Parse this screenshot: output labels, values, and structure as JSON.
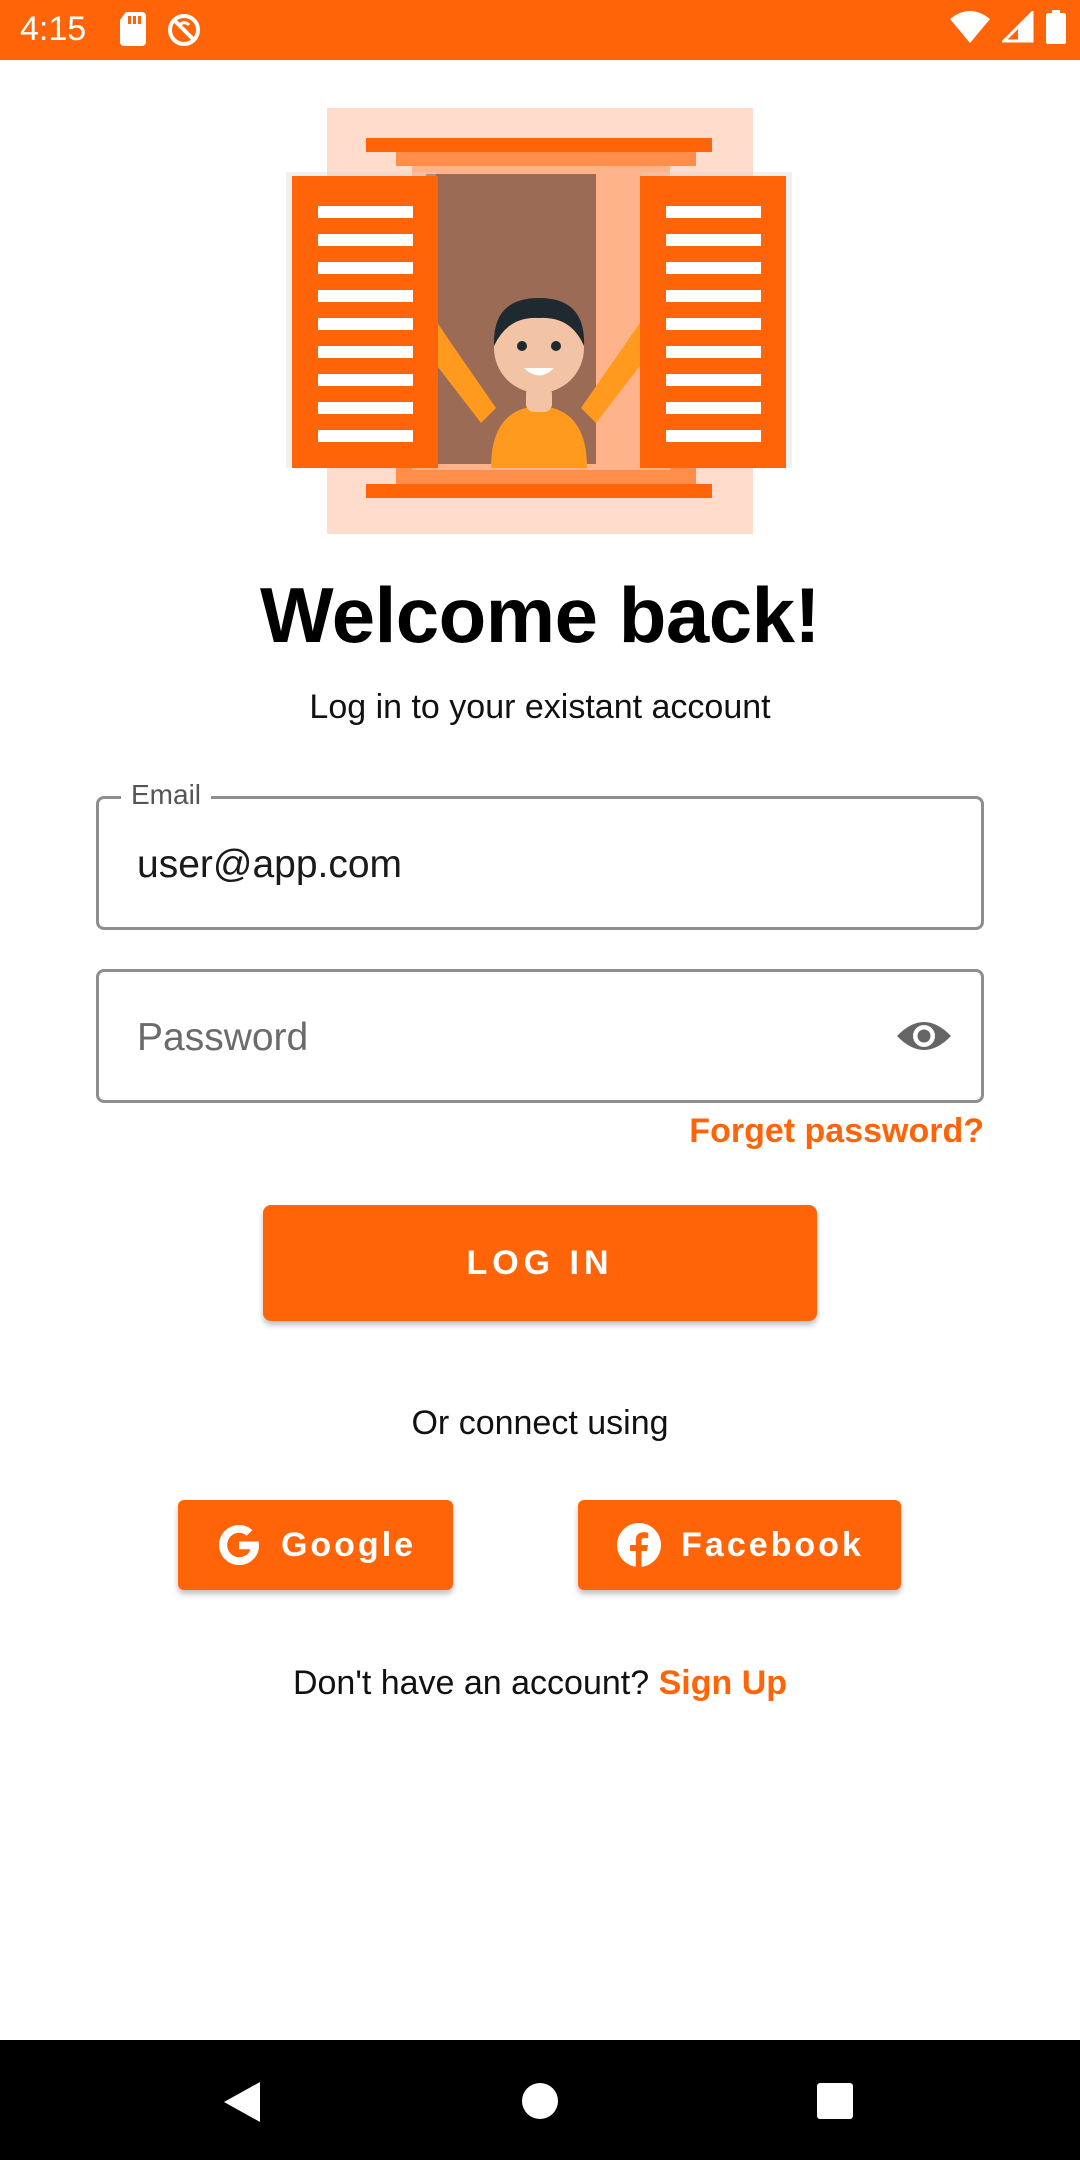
{
  "status_bar": {
    "time": "4:15",
    "left_icons": [
      "sd-card-icon",
      "sync-disabled-icon"
    ],
    "right_icons": [
      "wifi-icon",
      "cell-signal-icon",
      "battery-icon"
    ],
    "color": "#FF6508"
  },
  "hero": {
    "icon": "window-person-illustration"
  },
  "header": {
    "title": "Welcome back!",
    "subtitle": "Log in to your existant account"
  },
  "form": {
    "email": {
      "label": "Email",
      "value": "user@app.com"
    },
    "password": {
      "placeholder": "Password",
      "icon": "eye-icon"
    },
    "forgot_label": "Forget password?",
    "login_label": "LOG IN"
  },
  "social": {
    "prompt": "Or connect using",
    "google_label": "Google",
    "facebook_label": "Facebook"
  },
  "signup": {
    "prompt": "Don't have an account?",
    "link_label": "Sign Up"
  },
  "nav_bar": {
    "icons": [
      "back-icon",
      "home-icon",
      "recent-apps-icon"
    ]
  },
  "colors": {
    "accent": "#FF6508",
    "background": "#FFFFFF"
  }
}
